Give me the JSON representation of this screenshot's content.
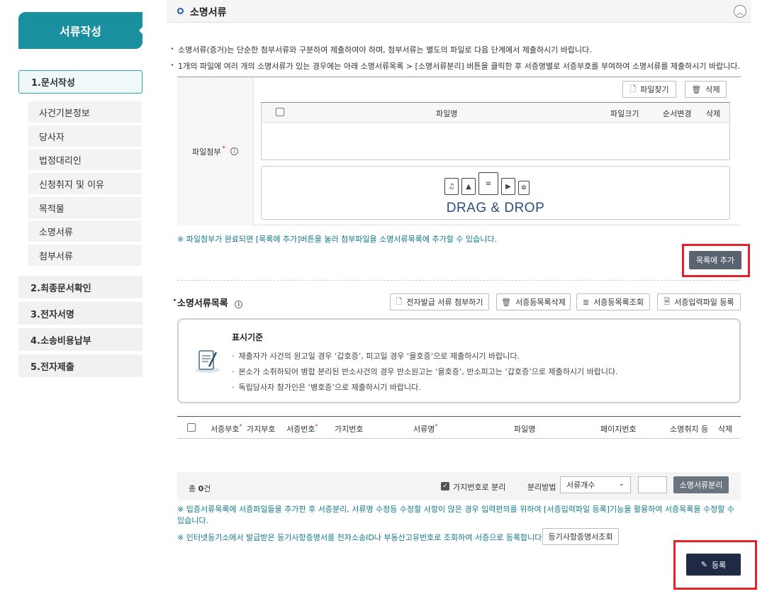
{
  "sidebar": {
    "title": "서류작성",
    "steps": [
      {
        "label": "1.문서작성"
      },
      {
        "label": "2.최종문서확인"
      },
      {
        "label": "3.전자서명"
      },
      {
        "label": "4.소송비용납부"
      },
      {
        "label": "5.전자제출"
      }
    ],
    "subitems": [
      {
        "label": "사건기본정보"
      },
      {
        "label": "당사자"
      },
      {
        "label": "법정대리인"
      },
      {
        "label": "신청취지 및 이유"
      },
      {
        "label": "목적물"
      },
      {
        "label": "소명서류"
      },
      {
        "label": "첨부서류"
      }
    ]
  },
  "section": {
    "title": "소명서류",
    "notes": [
      "소명서류(증거)는 단순한 첨부서류와 구분하여 제출하여야 하며, 첨부서류는 별도의 파일로 다음 단계에서 제출하시기 바랍니다.",
      "1개의 파일에 여러 개의 소명서류가 있는 경우에는 아래 소명서류목록 > [소명서류분리] 버튼을 클릭한 후 서증명별로 서증부호를 부여하여 소명서류를 제출하시기 바랍니다."
    ]
  },
  "attach": {
    "label": "파일첨부",
    "required_mark": "*",
    "find_button": "파일찾기",
    "delete_button": "삭제",
    "columns": {
      "name": "파일명",
      "size": "파일크기",
      "order": "순서변경",
      "delete": "삭제"
    },
    "drag_text": "DRAG & DROP",
    "note": "※ 파일첨부가 완료되면 [목록에 추가]버튼을 눌러 첨부파일을 소명서류목록에 추가할 수 있습니다.",
    "add_to_list_button": "목록에 추가"
  },
  "list": {
    "title": "소명서류목록",
    "buttons": {
      "attach_electronic": "전자발급 서류 첨부하기",
      "delete_list": "서증등목록삭제",
      "view_list": "서증등목록조회",
      "register_file": "서증입력파일 등록"
    },
    "criteria": {
      "title": "표시기준",
      "lines": [
        "제출자가 사건의 원고일 경우 ‘갑호증’, 피고일 경우 ‘을호증’으로 제출하시기 바랍니다.",
        "본소가 소취하되어 병합 분리된 반소사건의 경우 반소원고는 ‘을호증’, 반소피고는 ‘갑호증’으로 제출하시기 바랍니다.",
        "독립당사자 참가인은 ‘병호증’으로 제출하시기 바랍니다."
      ]
    },
    "columns": {
      "code": "서증부호",
      "branch": "가지부호",
      "number": "서증번호",
      "branch_no": "가지번호",
      "doc_name": "서류명",
      "file_name": "파일명",
      "page_no": "페이지번호",
      "withdraw": "소명취지 등",
      "delete": "삭제"
    }
  },
  "footer": {
    "total_prefix": "총",
    "total_count": "0",
    "total_suffix": "건",
    "split_by_branch": "가지번호로 분리",
    "split_method_label": "분리방법",
    "split_method_value": "서류개수",
    "split_button": "소명서류분리",
    "note1": "※ 입증서류목록에 서증파일들을 추가한 후 서증분리, 서류명 수정등 수정할 사항이 많은 경우 입력편의를 위하여 [서증입력파일 등록]기능을 활용하여 서증목록을 수정할 수 있습니다.",
    "note2": "※ 인터넷등기소에서 발급받은 등기사항증명서를 전자소송ID나 부동산고유번호로 조회하여 서증으로 등록합니다.",
    "registry_button": "등기사항증명서조회",
    "register_button": "등록"
  },
  "colors": {
    "accent": "#1a8f9e",
    "dark_button": "#5a6470",
    "navy_button": "#1f2a44",
    "highlight": "#e2222a"
  }
}
